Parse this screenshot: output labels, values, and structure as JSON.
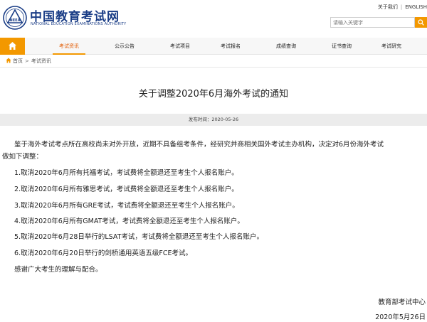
{
  "header": {
    "site_name": "中国教育考试网",
    "site_sub": "NATIONAL EDUCATION EXAMINATIONS AUTHORITY",
    "logo_text": "NEEA",
    "links": [
      "关于我们",
      "ENGLISH"
    ],
    "search_placeholder": "请输入关键字",
    "accent_color": "#f39800",
    "brand_color": "#1a3d86"
  },
  "nav": {
    "home_icon": "home-icon",
    "items": [
      "考试资讯",
      "公示公告",
      "考试项目",
      "考试报名",
      "成绩查询",
      "证书查询",
      "考试研究"
    ],
    "active_index": 0
  },
  "breadcrumb": {
    "items": [
      "首页",
      "考试资讯"
    ],
    "separator": ">"
  },
  "article": {
    "title": "关于调整2020年6月海外考试的通知",
    "meta": "发布时间：2020-05-26",
    "intro_line1": "鉴于海外考试考点所在高校尚未对外开放，近期不具备组考条件，经研究并商相关国外考试主办机构，决定对6月份海外考试",
    "intro_line2": "做如下调整：",
    "items": [
      "1.取消2020年6月所有托福考试，考试费将全额退还至考生个人报名账户。",
      "2.取消2020年6月所有雅思考试，考试费将全额退还至考生个人报名账户。",
      "3.取消2020年6月所有GRE考试，考试费将全额退还至考生个人报名账户。",
      "4.取消2020年6月所有GMAT考试，考试费将全额退还至考生个人报名账户。",
      "5.取消2020年6月28日举行的LSAT考试，考试费将全额退还至考生个人报名账户。",
      "6.取消2020年6月20日举行的剑桥通用英语五级FCE考试。"
    ],
    "closing": "感谢广大考生的理解与配合。",
    "signature": "教育部考试中心",
    "date": "2020年5月26日"
  }
}
